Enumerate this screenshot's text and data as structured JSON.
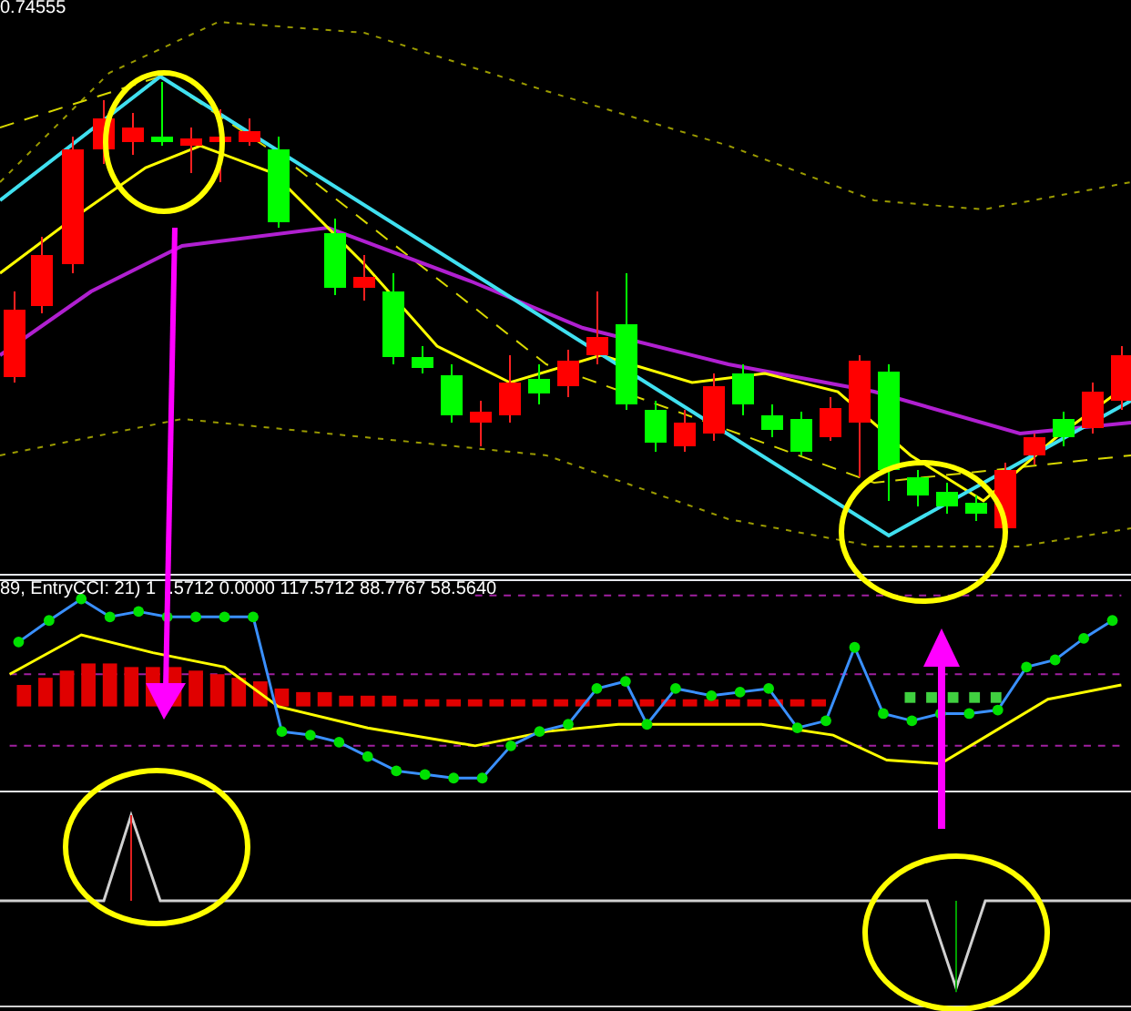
{
  "price_pane": {
    "reading": "0.74555"
  },
  "indicator_pane": {
    "label": "89, EntryCCI: 21) 1",
    "values": ".5712 0.0000 117.5712 88.7767 58.5640"
  }
}
